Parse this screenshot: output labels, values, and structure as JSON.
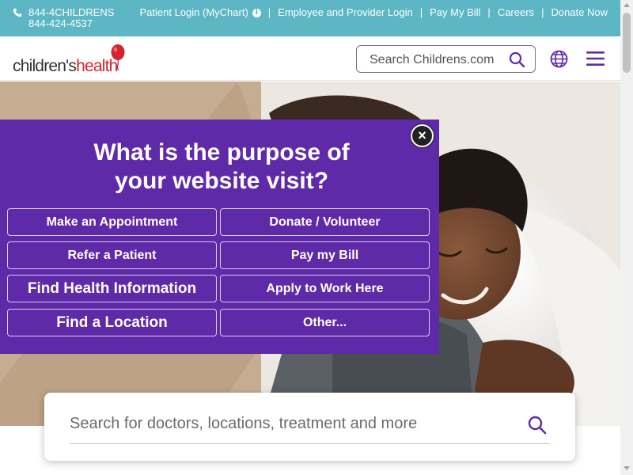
{
  "topbar": {
    "phone_line1": "844-4CHILDRENS",
    "phone_line2": "844-424-4537",
    "links": {
      "patient_login": "Patient Login (MyChart)",
      "employee_login": "Employee and Provider Login",
      "pay_bill": "Pay My Bill",
      "careers": "Careers",
      "donate": "Donate Now"
    },
    "separator": "|",
    "info_glyph": "i",
    "bg_color": "#5cb6c4"
  },
  "header": {
    "logo_part1": "children's",
    "logo_part2": "health",
    "search_placeholder": "Search Childrens.com",
    "icons": [
      "search-icon",
      "globe-icon",
      "menu-icon"
    ]
  },
  "modal": {
    "title_line1": "What is the purpose of",
    "title_line2": "your website visit?",
    "close_glyph": "×",
    "bg_color": "#5e2aa8",
    "options": [
      "Make an Appointment",
      "Donate / Volunteer",
      "Refer a Patient",
      "Pay my Bill",
      "Find Health Information",
      "Apply to Work Here",
      "Find a Location",
      "Other..."
    ]
  },
  "main_search": {
    "placeholder": "Search for doctors, locations, treatment and more"
  },
  "colors": {
    "accent_purple": "#5e2aa8",
    "brand_red": "#d6242f",
    "teal": "#5cb6c4"
  }
}
